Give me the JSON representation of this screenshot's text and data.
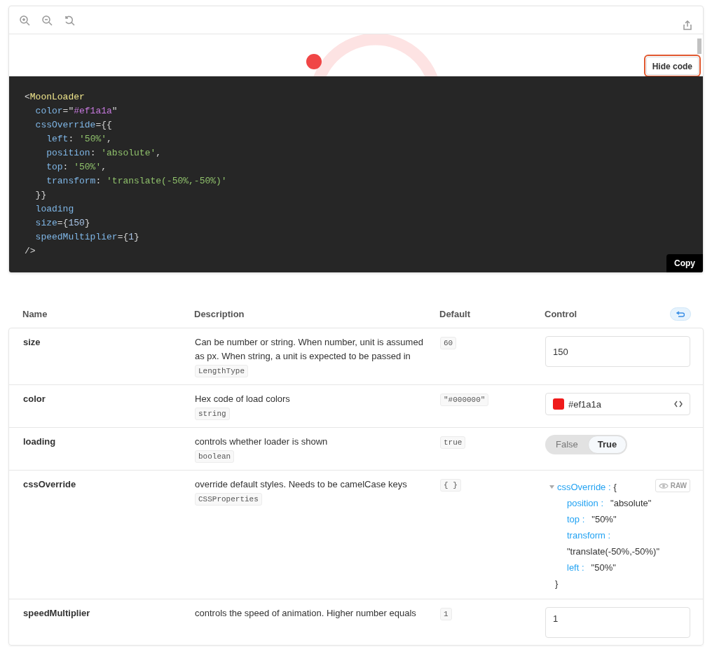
{
  "preview": {
    "hide_code_button": "Hide code",
    "hide_code_focused": true
  },
  "code": {
    "copy_button": "Copy",
    "lines": [
      [
        {
          "text": "<",
          "kind": "punct"
        },
        {
          "text": "MoonLoader",
          "kind": "tag"
        }
      ],
      [
        {
          "text": "  color",
          "kind": "attr"
        },
        {
          "text": "=\"",
          "kind": "punct"
        },
        {
          "text": "#ef1a1a",
          "kind": "value"
        },
        {
          "text": "\"",
          "kind": "punct"
        }
      ],
      [
        {
          "text": "  cssOverride",
          "kind": "attr"
        },
        {
          "text": "={{",
          "kind": "punct"
        }
      ],
      [
        {
          "text": "    left",
          "kind": "attr"
        },
        {
          "text": ": ",
          "kind": "punct"
        },
        {
          "text": "'50%'",
          "kind": "string"
        },
        {
          "text": ",",
          "kind": "punct"
        }
      ],
      [
        {
          "text": "    position",
          "kind": "attr"
        },
        {
          "text": ": ",
          "kind": "punct"
        },
        {
          "text": "'absolute'",
          "kind": "string"
        },
        {
          "text": ",",
          "kind": "punct"
        }
      ],
      [
        {
          "text": "    top",
          "kind": "attr"
        },
        {
          "text": ": ",
          "kind": "punct"
        },
        {
          "text": "'50%'",
          "kind": "string"
        },
        {
          "text": ",",
          "kind": "punct"
        }
      ],
      [
        {
          "text": "    transform",
          "kind": "attr"
        },
        {
          "text": ": ",
          "kind": "punct"
        },
        {
          "text": "'translate(-50%,-50%)'",
          "kind": "string"
        }
      ],
      [
        {
          "text": "  }}",
          "kind": "punct"
        }
      ],
      [
        {
          "text": "  loading",
          "kind": "attr"
        }
      ],
      [
        {
          "text": "  size",
          "kind": "attr"
        },
        {
          "text": "={",
          "kind": "punct"
        },
        {
          "text": "150",
          "kind": "number"
        },
        {
          "text": "}",
          "kind": "punct"
        }
      ],
      [
        {
          "text": "  speedMultiplier",
          "kind": "attr"
        },
        {
          "text": "={",
          "kind": "punct"
        },
        {
          "text": "1",
          "kind": "number"
        },
        {
          "text": "}",
          "kind": "punct"
        }
      ],
      [
        {
          "text": "/>",
          "kind": "punct"
        }
      ]
    ]
  },
  "args_table": {
    "columns": [
      "Name",
      "Description",
      "Default",
      "Control"
    ],
    "rows": [
      {
        "name": "size",
        "description": "Can be number or string. When number, unit is assumed as px. When string, a unit is expected to be passed in",
        "type": "LengthType",
        "default": "60",
        "control": {
          "kind": "number",
          "value": "150"
        }
      },
      {
        "name": "color",
        "description": "Hex code of load colors",
        "type": "string",
        "default": "\"#000000\"",
        "control": {
          "kind": "color",
          "value": "#ef1a1a"
        }
      },
      {
        "name": "loading",
        "description": "controls whether loader is shown",
        "type": "boolean",
        "default": "true",
        "control": {
          "kind": "boolean",
          "options": [
            {
              "label": "False",
              "selected": false
            },
            {
              "label": "True",
              "selected": true
            }
          ]
        }
      },
      {
        "name": "cssOverride",
        "description": "override default styles. Needs to be camelCase keys",
        "type": "CSSProperties",
        "default": "{ }",
        "control": {
          "kind": "object",
          "raw_button": "RAW",
          "root": {
            "key": "cssOverride :",
            "open": "{",
            "close": "}",
            "expanded": true,
            "children": [
              {
                "key": "position :",
                "value": "\"absolute\""
              },
              {
                "key": "top :",
                "value": "\"50%\""
              },
              {
                "key": "transform :",
                "value": "\"translate(-50%,-50%)\""
              },
              {
                "key": "left :",
                "value": "\"50%\""
              }
            ]
          }
        }
      },
      {
        "name": "speedMultiplier",
        "description": "controls the speed of animation. Higher number equals",
        "default": "1",
        "control": {
          "kind": "number",
          "value": "1"
        }
      }
    ]
  }
}
